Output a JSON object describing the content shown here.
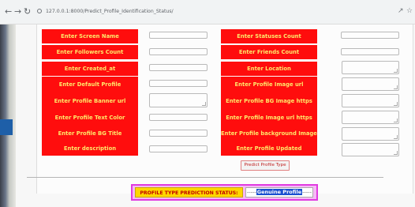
{
  "browser": {
    "url": "127.0.0.1:8000/Predict_Profile_Identification_Status/",
    "back_icon": "arrow-left",
    "forward_icon": "arrow-right",
    "reload_icon": "reload",
    "share_icon": "share",
    "star_icon": "star"
  },
  "form": {
    "left_labels": [
      "Enter Screen Name",
      "Enter Followers Count",
      "Enter Created_at",
      "Enter Default Profile",
      "Enter Profile Banner url",
      "Enter Profile Text Color",
      "Enter Profile BG Title",
      "Enter description"
    ],
    "right_labels": [
      "Enter Statuses Count",
      "Enter Friends Count",
      "Enter Location",
      "Enter Profile Image url",
      "Enter Profile BG Image https",
      "Enter Profile Image url https",
      "Enter Profile background Image url",
      "Enter Profile Updated"
    ],
    "submit_label": "Predict Profile Type"
  },
  "result": {
    "label": "PROFILE TYPE PREDICTION STATUS:",
    "dash_left": "-----",
    "value": "Genuine Profile",
    "dash_right": "-----"
  },
  "colors": {
    "label_bg": "#ff0d0d",
    "label_text": "#ffe86a",
    "status_border": "#e03be0",
    "status_label_bg": "#ffd700",
    "status_label_text": "#c00000",
    "value_highlight": "#1a50d0"
  }
}
